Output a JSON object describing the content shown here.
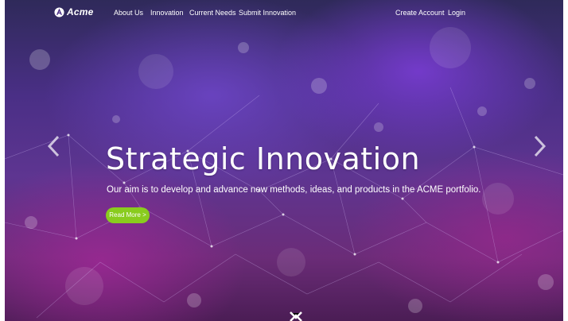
{
  "brand": {
    "name": "Acme"
  },
  "nav": {
    "links": [
      "About Us",
      "Innovation",
      "Current Needs",
      "Submit Innovation"
    ],
    "account": [
      "Create Account",
      "Login"
    ]
  },
  "hero": {
    "title": "Strategic Innovation",
    "subtitle": "Our aim is to develop and advance new methods, ideas, and products in the ACME portfolio.",
    "button_label": "Read More >"
  },
  "icons": {
    "logo": "acme-logo-icon",
    "prev": "chevron-left-icon",
    "next": "chevron-right-icon",
    "scroll": "chevron-down-icon"
  },
  "colors": {
    "button": "#89cc1e",
    "text": "#ffffff"
  }
}
